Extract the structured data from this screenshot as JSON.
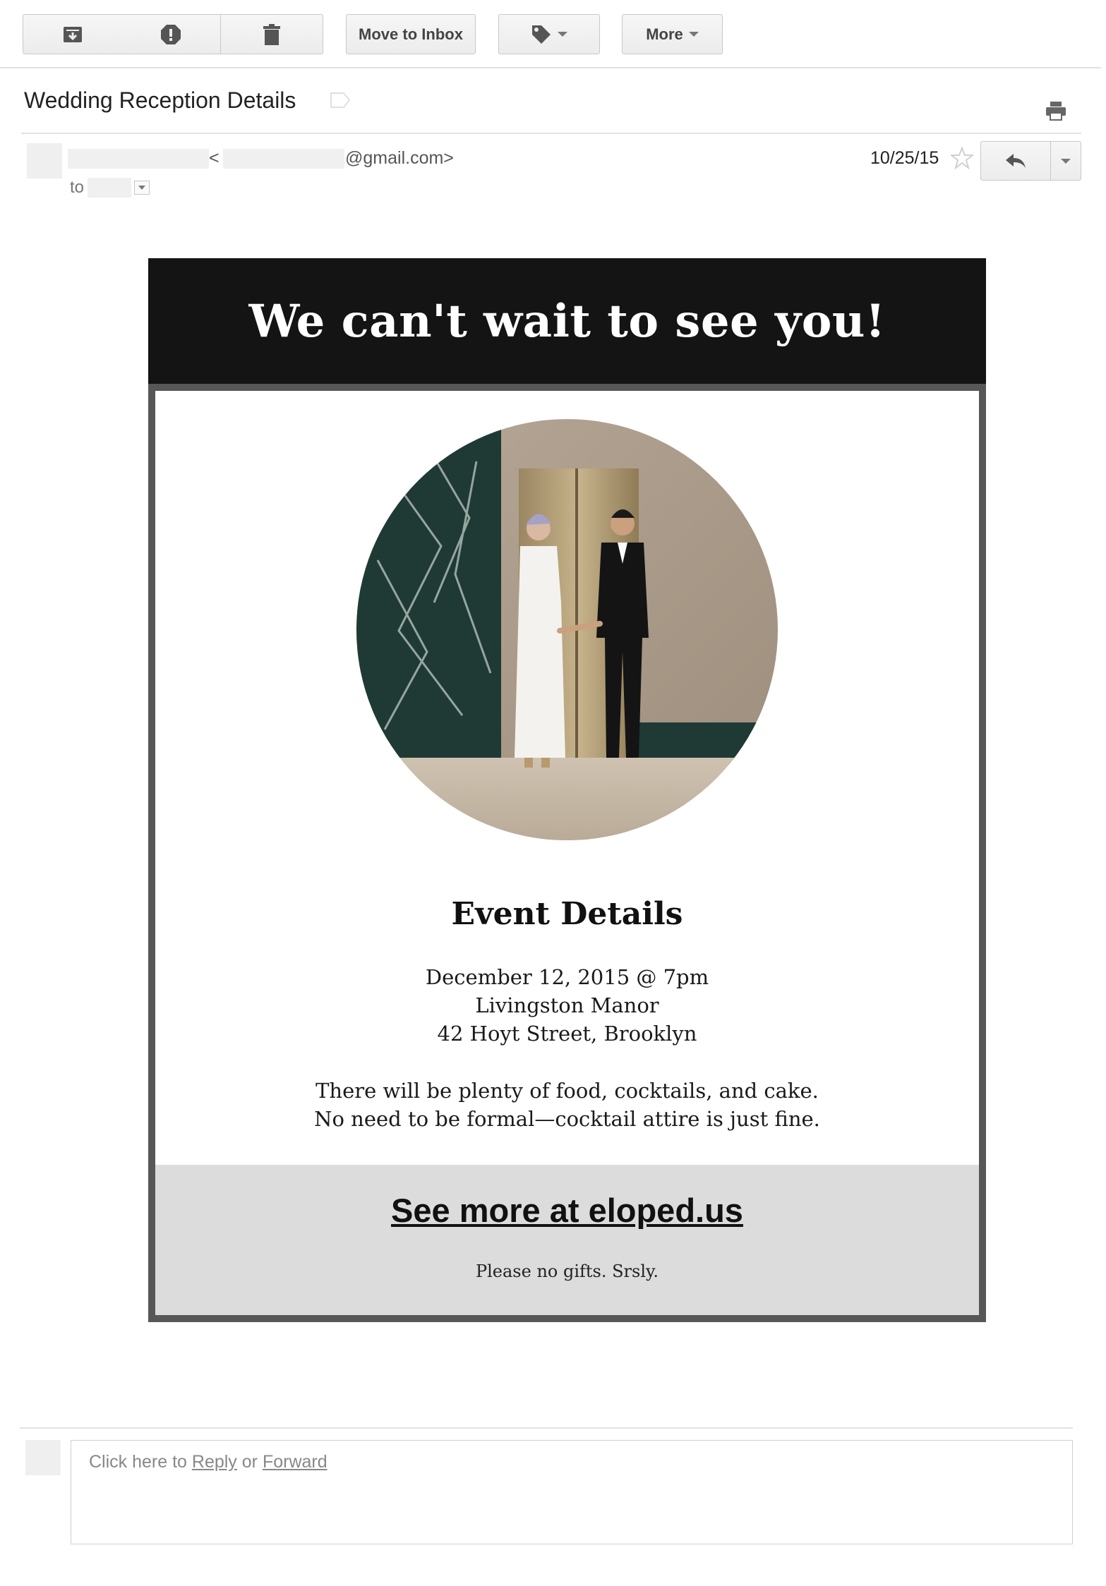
{
  "toolbar": {
    "archive_icon": "archive-icon",
    "spam_icon": "report-spam-icon",
    "delete_icon": "trash-icon",
    "move_to_inbox": "Move to Inbox",
    "labels_icon": "label-tag-icon",
    "more": "More"
  },
  "message": {
    "subject": "Wedding Reception Details",
    "sender_lt": "<",
    "sender_domain": "@gmail.com>",
    "to_label": "to",
    "date": "10/25/15"
  },
  "email_body": {
    "headline": "We can't wait to see you!",
    "details_title": "Event Details",
    "date_line": "December 12, 2015 @ 7pm",
    "venue": "Livingston Manor",
    "address": "42 Hoyt Street, Brooklyn",
    "note_line1": "There will be plenty of food, cocktails, and cake.",
    "note_line2": "No need to be formal—cocktail attire is just fine.",
    "link_text": "See more at eloped.us",
    "footer_note": "Please no gifts. Srsly."
  },
  "reply": {
    "prefix": "Click here to ",
    "reply_link": "Reply",
    "or": " or ",
    "forward_link": "Forward"
  },
  "colors": {
    "header_bg": "#141414",
    "frame": "#575757",
    "footer_bg": "#dcdcdc"
  }
}
